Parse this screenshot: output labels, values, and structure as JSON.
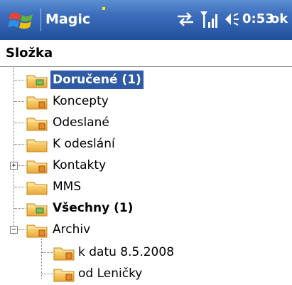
{
  "titlebar": {
    "app_title": "Magic",
    "time": "0:53",
    "ok_label": "ok",
    "icons": [
      "windows-start-icon",
      "sync-icon",
      "signal-icon",
      "volume-icon"
    ],
    "colors": {
      "bar_top": "#5d8fd3",
      "bar_bottom": "#214f9c",
      "selection": "#2f5aa5"
    }
  },
  "header": {
    "title": "Složka"
  },
  "folders": [
    {
      "label": "Doručené (1)",
      "selected": true,
      "bold": true,
      "icon": "inbox-folder-icon"
    },
    {
      "label": "Koncepty",
      "icon": "drafts-folder-icon"
    },
    {
      "label": "Odeslané",
      "icon": "sent-folder-icon"
    },
    {
      "label": "K odeslání",
      "icon": "outbox-folder-icon"
    },
    {
      "label": "Kontakty",
      "expandable": true,
      "expanded": false,
      "icon": "contacts-folder-icon"
    },
    {
      "label": "MMS",
      "icon": "folder-icon"
    },
    {
      "label": "Všechny (1)",
      "bold": true,
      "icon": "all-folder-icon"
    },
    {
      "label": "Archiv",
      "expandable": true,
      "expanded": true,
      "icon": "archive-folder-icon",
      "children": [
        {
          "label": "k datu 8.5.2008",
          "icon": "folder-icon"
        },
        {
          "label": "od Leničky",
          "icon": "folder-icon"
        }
      ]
    }
  ]
}
